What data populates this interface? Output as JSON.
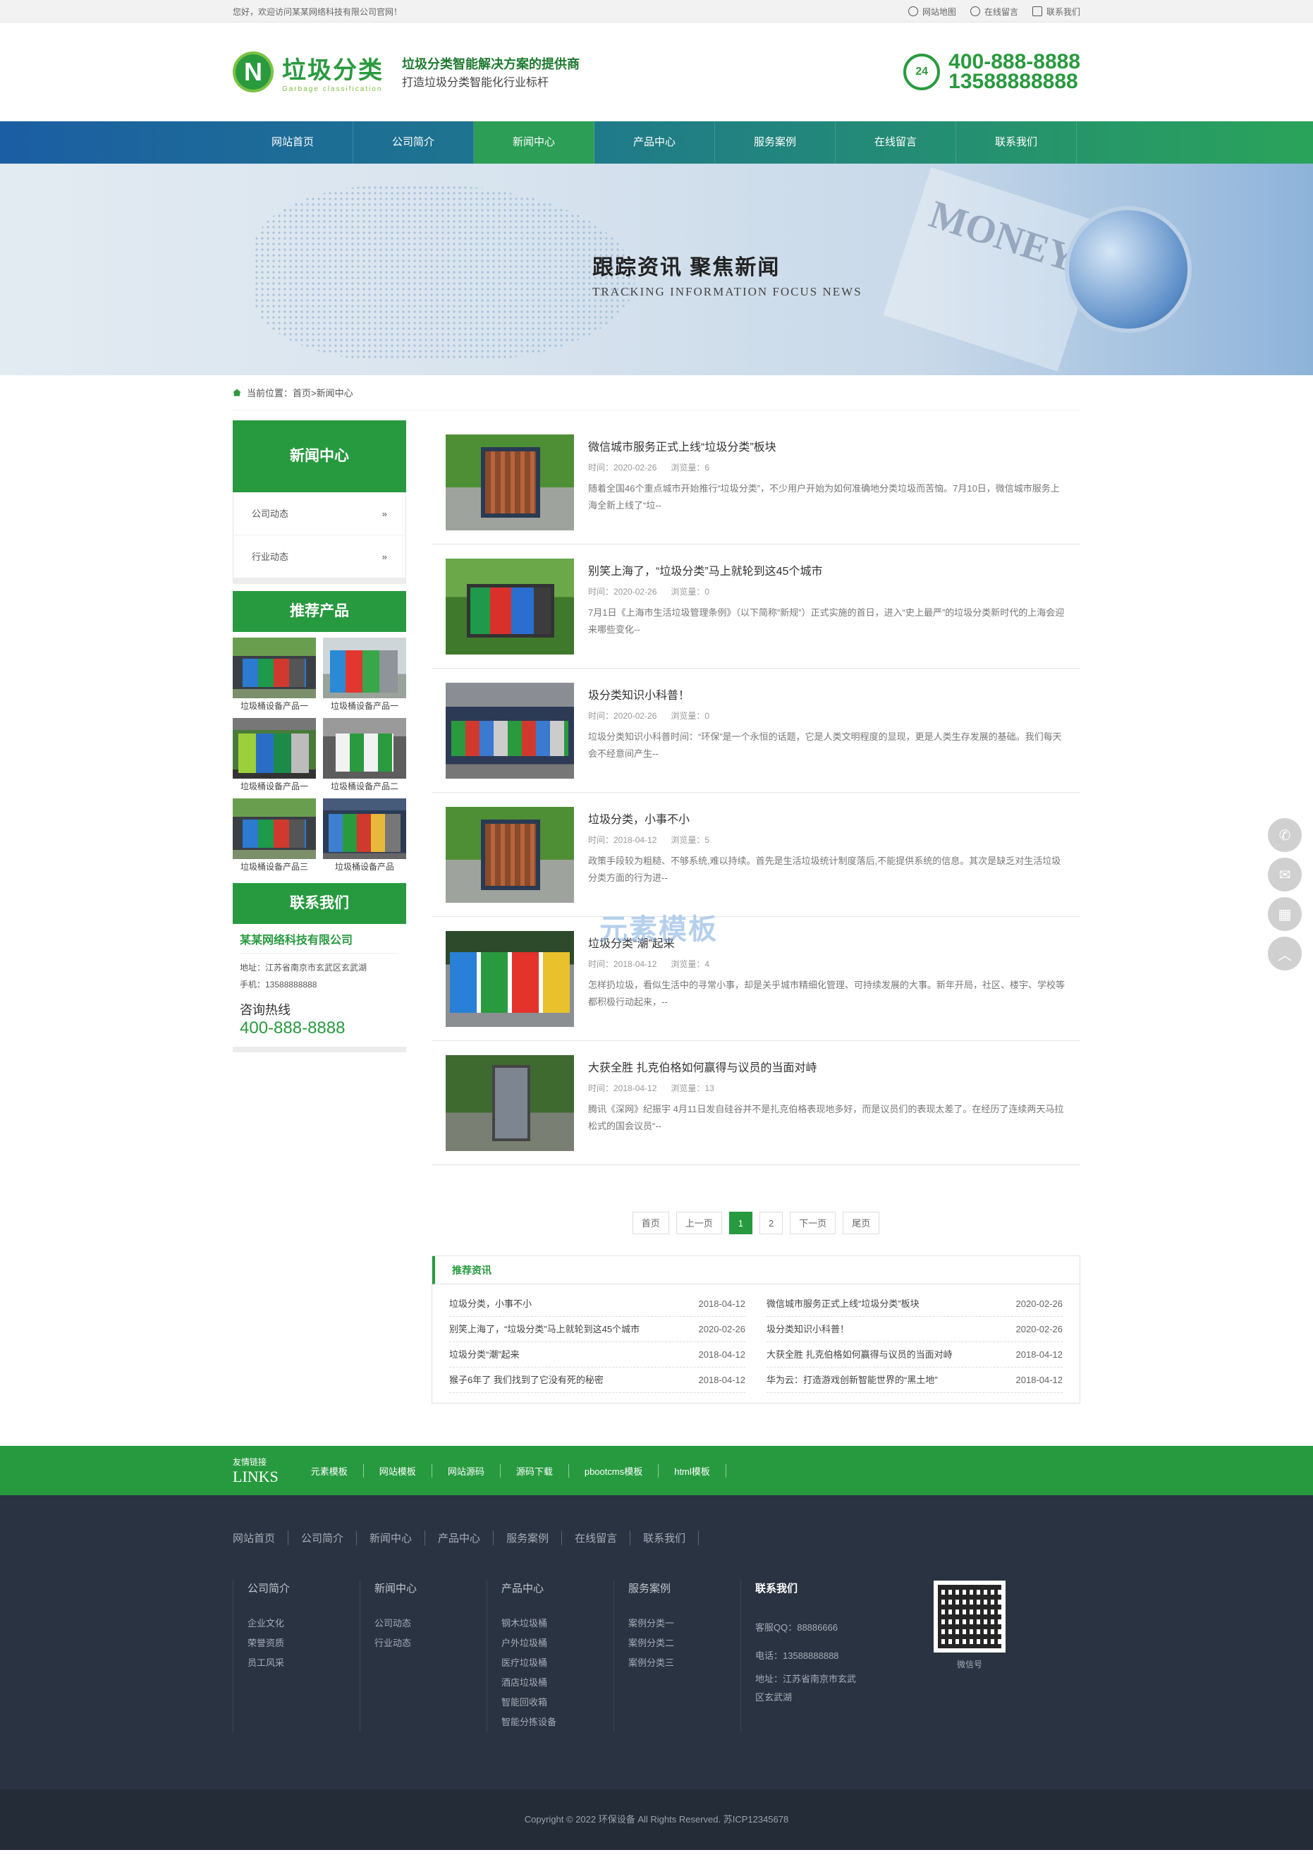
{
  "topbar": {
    "welcome": "您好，欢迎访问某某网络科技有限公司官网！",
    "links": [
      "网站地图",
      "在线留言",
      "联系我们"
    ]
  },
  "header": {
    "logo_text": "垃圾分类",
    "logo_en": "Garbage classification",
    "slogan1": "垃圾分类智能解决方案的提供商",
    "slogan2": "打造垃圾分类智能化行业标杆",
    "phone1": "400-888-8888",
    "phone2": "13588888888",
    "phone_badge": "24"
  },
  "nav": [
    "网站首页",
    "公司简介",
    "新闻中心",
    "产品中心",
    "服务案例",
    "在线留言",
    "联系我们"
  ],
  "banner": {
    "title": "跟踪资讯  聚焦新闻",
    "subtitle": "TRACKING INFORMATION FOCUS NEWS",
    "paper_text": "MONEY"
  },
  "breadcrumb": "当前位置：首页>新闻中心",
  "sidebar": {
    "news_title": "新闻中心",
    "news_menu": [
      "公司动态",
      "行业动态"
    ],
    "products_title": "推荐产品",
    "products": [
      "垃圾桶设备产品一",
      "垃圾桶设备产品一",
      "垃圾桶设备产品一",
      "垃圾桶设备产品二",
      "垃圾桶设备产品三",
      "垃圾桶设备产品"
    ],
    "contact_title": "联系我们",
    "company": "某某网络科技有限公司",
    "address": "地址：江苏省南京市玄武区玄武湖",
    "mobile": "手机：13588888888",
    "hotline_label": "咨询热线",
    "hotline": "400-888-8888"
  },
  "news": [
    {
      "title": "微信城市服务正式上线“垃圾分类”板块",
      "time": "时间：2020-02-26",
      "views": "浏览量：6",
      "desc": "随着全国46个重点城市开始推行“垃圾分类”，不少用户开始为如何准确地分类垃圾而苦恼。7月10日，微信城市服务上海全新上线了“垃--"
    },
    {
      "title": "别笑上海了，“垃圾分类”马上就轮到这45个城市",
      "time": "时间：2020-02-26",
      "views": "浏览量：0",
      "desc": "7月1日《上海市生活垃圾管理条例》（以下简称“新规”）正式实施的首日，进入“史上最严”的垃圾分类新时代的上海会迎来哪些变化--"
    },
    {
      "title": "圾分类知识小科普！",
      "time": "时间：2020-02-26",
      "views": "浏览量：0",
      "desc": "垃圾分类知识小科普时间：“环保”是一个永恒的话题，它是人类文明程度的显现，更是人类生存发展的基础。我们每天会不经意间产生--"
    },
    {
      "title": "垃圾分类，小事不小",
      "time": "时间：2018-04-12",
      "views": "浏览量：5",
      "desc": "政策手段较为粗糙、不够系统,难以持续。首先是生活垃圾统计制度落后,不能提供系统的信息。其次是缺乏对生活垃圾分类方面的行为进--"
    },
    {
      "title": "垃圾分类“潮”起来",
      "time": "时间：2018-04-12",
      "views": "浏览量：4",
      "desc": "怎样扔垃圾，看似生活中的寻常小事，却是关乎城市精细化管理、可持续发展的大事。新年开局，社区、楼宇、学校等都积极行动起来，--"
    },
    {
      "title": "大获全胜 扎克伯格如何赢得与议员的当面对峙",
      "time": "时间：2018-04-12",
      "views": "浏览量：13",
      "desc": "腾讯《深网》纪振宇 4月11日发自硅谷并不是扎克伯格表现地多好，而是议员们的表现太差了。在经历了连续两天马拉松式的国会议员“--"
    }
  ],
  "pager": [
    "首页",
    "上一页",
    "1",
    "2",
    "下一页",
    "尾页"
  ],
  "recommend": {
    "title": "推荐资讯",
    "left": [
      {
        "t": "垃圾分类，小事不小",
        "d": "2018-04-12"
      },
      {
        "t": "别笑上海了，“垃圾分类”马上就轮到这45个城市",
        "d": "2020-02-26"
      },
      {
        "t": "垃圾分类“潮”起来",
        "d": "2018-04-12"
      },
      {
        "t": "猴子6年了 我们找到了它没有死的秘密",
        "d": "2018-04-12"
      }
    ],
    "right": [
      {
        "t": "微信城市服务正式上线“垃圾分类”板块",
        "d": "2020-02-26"
      },
      {
        "t": "圾分类知识小科普！",
        "d": "2020-02-26"
      },
      {
        "t": "大获全胜 扎克伯格如何赢得与议员的当面对峙",
        "d": "2018-04-12"
      },
      {
        "t": "华为云：打造游戏创新智能世界的“黑土地”",
        "d": "2018-04-12"
      }
    ]
  },
  "watermark": "元素模板",
  "links": {
    "label_cn": "友情链接",
    "label_en": "LINKS",
    "items": [
      "元素模板",
      "网站模板",
      "网站源码",
      "源码下载",
      "pbootcms模板",
      "html模板"
    ]
  },
  "footer": {
    "nav": [
      "网站首页",
      "公司简介",
      "新闻中心",
      "产品中心",
      "服务案例",
      "在线留言",
      "联系我们"
    ],
    "cols": [
      {
        "h": "公司简介",
        "items": [
          "企业文化",
          "荣誉资质",
          "员工风采"
        ]
      },
      {
        "h": "新闻中心",
        "items": [
          "公司动态",
          "行业动态"
        ]
      },
      {
        "h": "产品中心",
        "items": [
          "钢木垃圾桶",
          "户外垃圾桶",
          "医疗垃圾桶",
          "酒店垃圾桶",
          "智能回收箱",
          "智能分拣设备"
        ]
      },
      {
        "h": "服务案例",
        "items": [
          "案例分类一",
          "案例分类二",
          "案例分类三"
        ]
      }
    ],
    "contact_h": "联系我们",
    "qq": "客服QQ：88886666",
    "tel": "电话：13588888888",
    "addr1": "地址：江苏省南京市玄武",
    "addr2": "区玄武湖",
    "qr_label": "微信号",
    "copyright": "Copyright © 2022 环保设备 All Rights Reserved. 苏ICP12345678"
  },
  "colors": {
    "brand_green": "#279a3f",
    "footer_bg": "#2a3341"
  }
}
